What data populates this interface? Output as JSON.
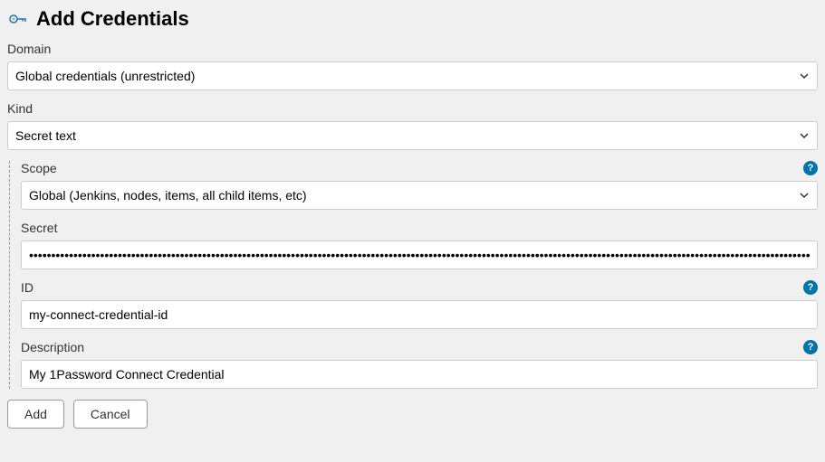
{
  "header": {
    "title": "Add Credentials"
  },
  "form": {
    "domain": {
      "label": "Domain",
      "value": "Global credentials (unrestricted)"
    },
    "kind": {
      "label": "Kind",
      "value": "Secret text"
    },
    "scope": {
      "label": "Scope",
      "value": "Global (Jenkins, nodes, items, all child items, etc)"
    },
    "secret": {
      "label": "Secret",
      "value": "••••••••••••••••••••••••••••••••••••••••••••••••••••••••••••••••••••••••••••••••••••••••••••••••••••••••••••••••••••••••••••••••••••••••••••••••••••••••••••••••••••••••••••••••••••••••••••••••••••••••••••••••••••••••••••••••••••••••••••••••••••••••••••••••"
    },
    "id": {
      "label": "ID",
      "value": "my-connect-credential-id"
    },
    "description": {
      "label": "Description",
      "value": "My 1Password Connect Credential"
    }
  },
  "buttons": {
    "add": "Add",
    "cancel": "Cancel"
  },
  "help_tooltip": "?"
}
